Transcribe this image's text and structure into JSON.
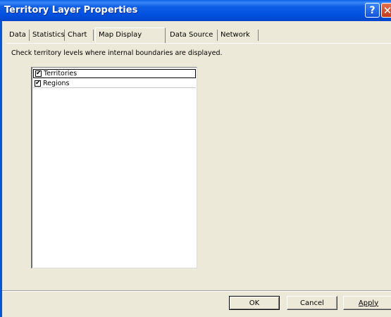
{
  "window": {
    "title": "Territory Layer Properties",
    "help_glyph": "?",
    "close_glyph": "✕"
  },
  "tabs": [
    {
      "label": "Data",
      "selected": false
    },
    {
      "label": "Statistics",
      "selected": false
    },
    {
      "label": "Chart",
      "selected": false
    },
    {
      "label": "Map Display",
      "selected": true
    },
    {
      "label": "Data Source",
      "selected": false
    },
    {
      "label": "Network",
      "selected": false
    }
  ],
  "map_display": {
    "instruction": "Check territory levels where internal boundaries are displayed.",
    "levels": [
      {
        "label": "Territories",
        "checked": true
      },
      {
        "label": "Regions",
        "checked": true
      }
    ]
  },
  "buttons": {
    "ok": "OK",
    "cancel": "Cancel",
    "apply": "Apply"
  },
  "colors": {
    "titlebar": "#0050df",
    "dialog_bg": "#ece9d8"
  },
  "icons": {
    "check_glyph": "✔"
  }
}
